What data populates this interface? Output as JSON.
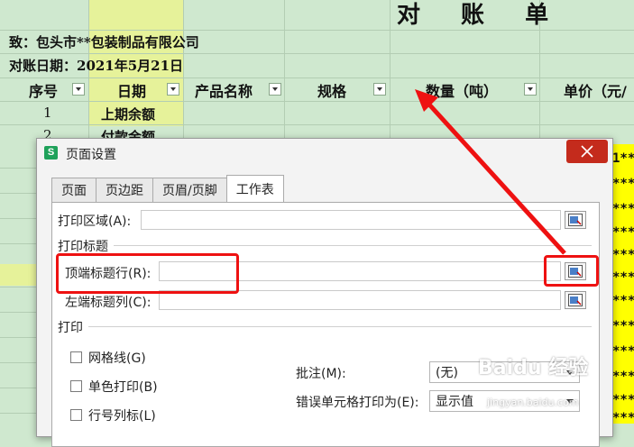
{
  "sheet": {
    "title": "对 账 单",
    "to_line": "致：包头市**包装制品有限公司",
    "date_line": "对账日期：2021年5月21日",
    "headers": {
      "seq": "序号",
      "date": "日期",
      "product": "产品名称",
      "spec": "规格",
      "qty": "数量（吨）",
      "price": "单价（元/"
    },
    "rows": [
      {
        "seq": "1",
        "label": "上期余额"
      },
      {
        "seq": "2",
        "label": "付款金额"
      }
    ],
    "masked_cells": [
      "1***",
      "***",
      "***",
      "***",
      "***",
      "***",
      "***",
      "***",
      "***",
      "***",
      "***",
      "***"
    ]
  },
  "dialog": {
    "title": "页面设置",
    "tabs": [
      "页面",
      "页边距",
      "页眉/页脚",
      "工作表"
    ],
    "active_tab": "工作表",
    "print_area_label": "打印区域(A):",
    "print_titles_section": "打印标题",
    "top_rows_label": "顶端标题行(R):",
    "left_cols_label": "左端标题列(C):",
    "print_section": "打印",
    "gridlines_label": "网格线(G)",
    "mono_label": "单色打印(B)",
    "rowcol_label": "行号列标(L)",
    "comments_label": "批注(M):",
    "comments_value": "(无)",
    "errors_label": "错误单元格打印为(E):",
    "errors_value": "显示值"
  },
  "colors": {
    "highlight": "#ee1111",
    "sheet_bg": "#cfe8cf",
    "close_btn": "#c42b1c"
  },
  "watermark": {
    "brand": "Baidu 经验",
    "url": "jingyan.baidu.com"
  }
}
